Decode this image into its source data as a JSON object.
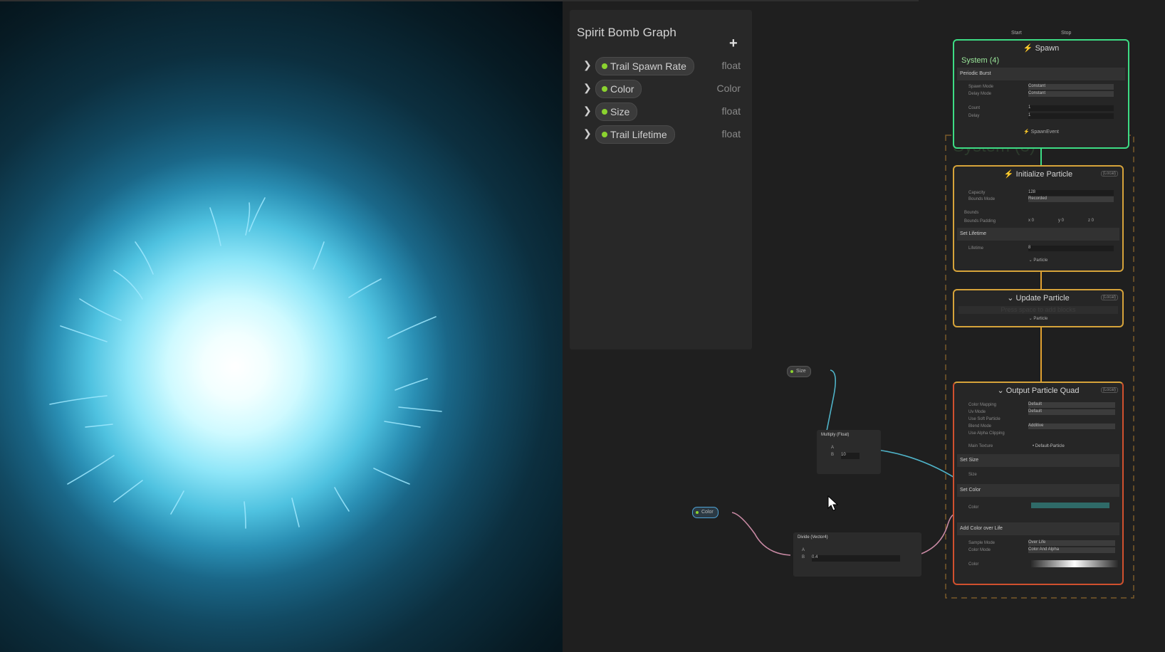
{
  "blackboard": {
    "title": "Spirit Bomb Graph",
    "add_label": "+",
    "properties": [
      {
        "name": "Trail Spawn Rate",
        "type": "float"
      },
      {
        "name": "Color",
        "type": "Color"
      },
      {
        "name": "Size",
        "type": "float"
      },
      {
        "name": "Trail Lifetime",
        "type": "float"
      }
    ]
  },
  "system_label": "System (8)",
  "spawn": {
    "start": "Start",
    "stop": "Stop",
    "title": "Spawn",
    "system": "System (4)",
    "block": "Periodic Burst",
    "spawn_mode_label": "Spawn Mode",
    "spawn_mode": "Constant",
    "delay_mode_label": "Delay Mode",
    "delay_mode": "Constant",
    "count_label": "Count",
    "count": "1",
    "delay_label": "Delay",
    "delay": "1",
    "footer": "SpawnEvent"
  },
  "init": {
    "title": "Initialize Particle",
    "badge": "(Local)",
    "capacity_label": "Capacity",
    "capacity": "128",
    "bounds_mode_label": "Bounds Mode",
    "bounds_mode": "Recorded",
    "bounds_label": "Bounds",
    "bounds_padding_label": "Bounds Padding",
    "pad_x": "x 0",
    "pad_y": "y 0",
    "pad_z": "z 0",
    "block": "Set Lifetime",
    "lifetime_label": "Lifetime",
    "lifetime": "8",
    "footer": "Particle"
  },
  "update": {
    "title": "Update Particle",
    "badge": "(Local)",
    "empty": "Press space to add blocks",
    "footer": "Particle"
  },
  "output": {
    "title": "Output Particle Quad",
    "badge": "(Local)",
    "uv_label": "Color Mapping",
    "uv": "Default",
    "uvmode_label": "Uv Mode",
    "uvmode": "Default",
    "soft_label": "Use Soft Particle",
    "blend_label": "Blend Mode",
    "blend": "Additive",
    "alpha_label": "Use Alpha Clipping",
    "tex_label": "Main Texture",
    "tex": "• Default-Particle",
    "set_size": "Set Size",
    "size_label": "Size",
    "set_color": "Set Color",
    "color_label": "Color",
    "add_col": "Add Color over Life",
    "sample_label": "Sample Mode",
    "sample": "Over Life",
    "colmode_label": "Color Mode",
    "colmode": "Color And Alpha",
    "col_label": "Color"
  },
  "size_param": "Size",
  "multiply": {
    "title": "Multiply (Float)",
    "a": "A",
    "b": "B",
    "b_val": "10"
  },
  "color_param": "Color",
  "divide": {
    "title": "Divide (Vector4)",
    "a": "A",
    "b": "B",
    "b_val": "0.4"
  },
  "colors": {
    "accent_green": "#3ddc84",
    "accent_orange": "#e0a030",
    "accent_red": "#d0502e",
    "param_green": "#8bd32f"
  }
}
